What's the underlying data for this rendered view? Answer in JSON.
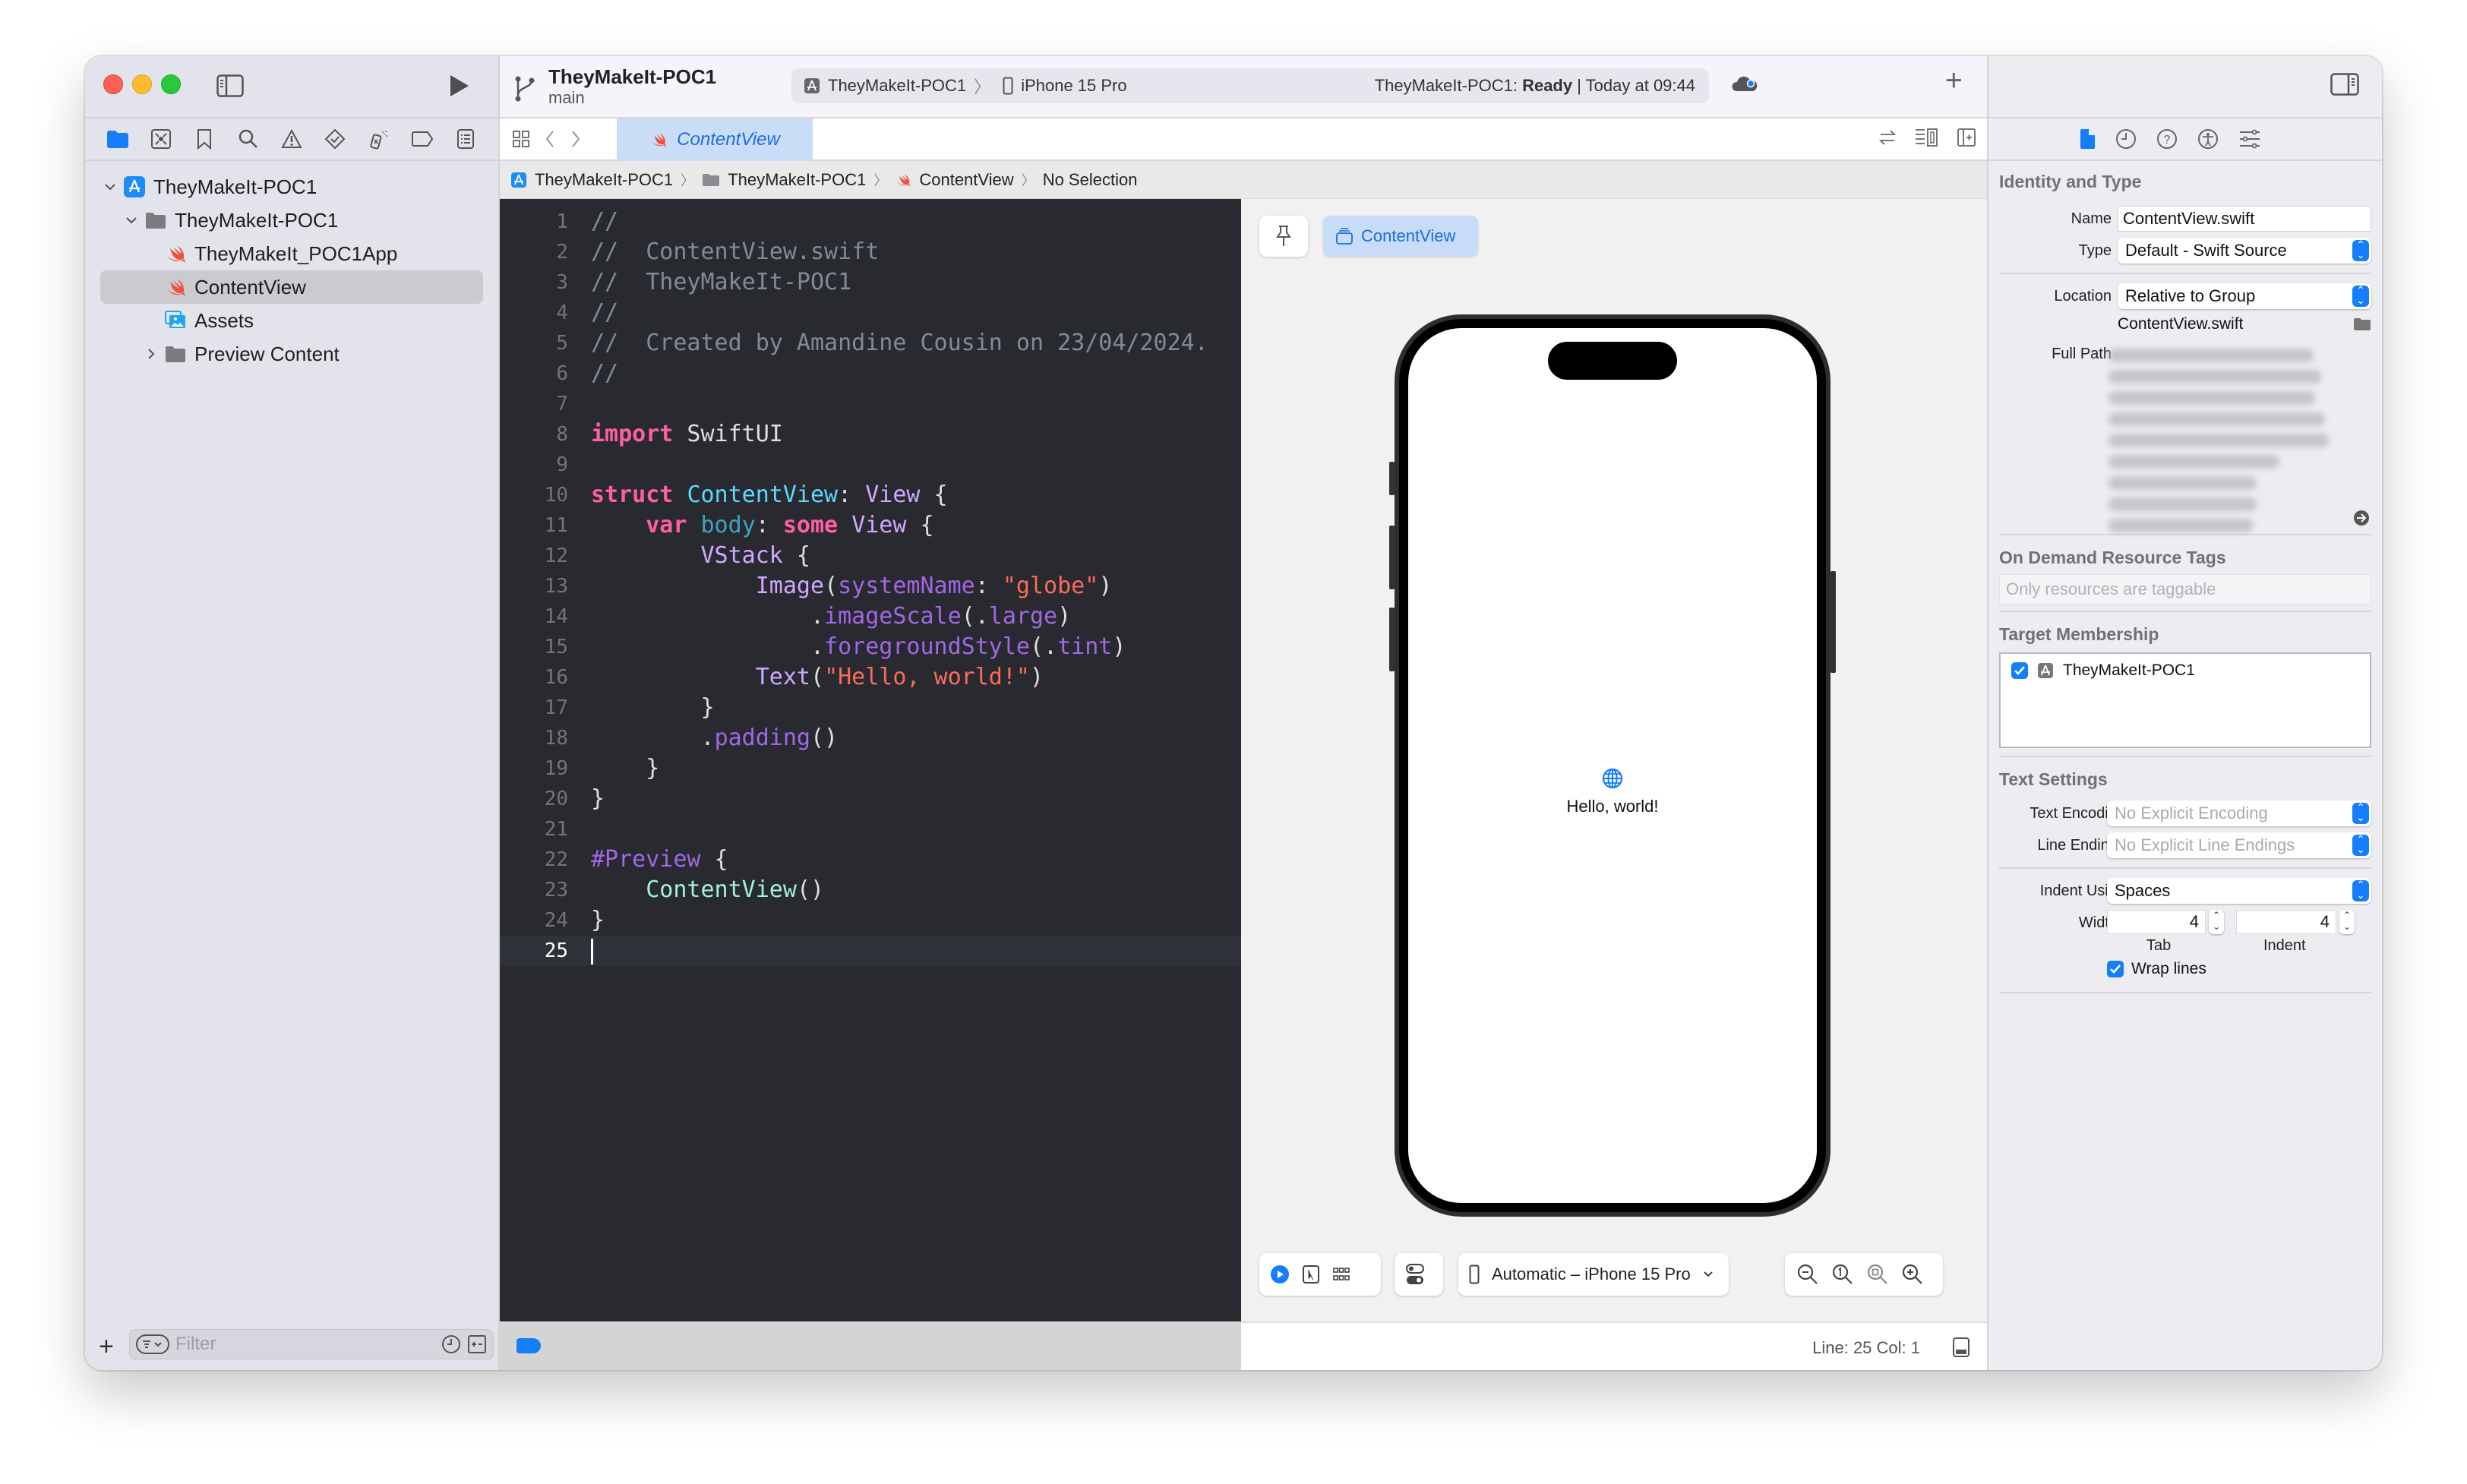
{
  "navigator": {
    "tabs": [
      "project-navigator",
      "source-control-navigator",
      "bookmark-navigator",
      "find-navigator",
      "issue-navigator",
      "test-navigator",
      "debug-navigator",
      "breakpoint-navigator",
      "report-navigator"
    ],
    "tree": [
      {
        "label": "TheyMakeIt-POC1",
        "type": "project",
        "depth": 0,
        "expanded": true
      },
      {
        "label": "TheyMakeIt-POC1",
        "type": "folder",
        "depth": 1,
        "expanded": true
      },
      {
        "label": "TheyMakeIt_POC1App",
        "type": "swift",
        "depth": 2
      },
      {
        "label": "ContentView",
        "type": "swift",
        "depth": 2,
        "selected": true
      },
      {
        "label": "Assets",
        "type": "assets",
        "depth": 2
      },
      {
        "label": "Preview Content",
        "type": "folder",
        "depth": 2,
        "expanded": false
      }
    ],
    "filter_placeholder": "Filter"
  },
  "toolbar": {
    "project_title": "TheyMakeIt-POC1",
    "branch": "main",
    "scheme": "TheyMakeIt-POC1",
    "destination": "iPhone 15 Pro",
    "status_prefix": "TheyMakeIt-POC1: ",
    "status_state": "Ready",
    "status_suffix": " | Today at 09:44"
  },
  "editor": {
    "tab_label": "ContentView",
    "jumpbar": [
      "TheyMakeIt-POC1",
      "TheyMakeIt-POC1",
      "ContentView",
      "No Selection"
    ],
    "current_line": 25,
    "lines": [
      [
        [
          "c",
          "//"
        ]
      ],
      [
        [
          "c",
          "//  ContentView.swift"
        ]
      ],
      [
        [
          "c",
          "//  TheyMakeIt-POC1"
        ]
      ],
      [
        [
          "c",
          "//"
        ]
      ],
      [
        [
          "c",
          "//  Created by Amandine Cousin on 23/04/2024."
        ]
      ],
      [
        [
          "c",
          "//"
        ]
      ],
      [],
      [
        [
          "k",
          "import"
        ],
        [
          "p",
          " SwiftUI"
        ]
      ],
      [],
      [
        [
          "k",
          "struct"
        ],
        [
          "p",
          " "
        ],
        [
          "t",
          "ContentView"
        ],
        [
          "p",
          ": "
        ],
        [
          "s",
          "View"
        ],
        [
          "p",
          " {"
        ]
      ],
      [
        [
          "p",
          "    "
        ],
        [
          "k",
          "var"
        ],
        [
          "p",
          " "
        ],
        [
          "r",
          "body"
        ],
        [
          "p",
          ": "
        ],
        [
          "k",
          "some"
        ],
        [
          "p",
          " "
        ],
        [
          "s",
          "View"
        ],
        [
          "p",
          " {"
        ]
      ],
      [
        [
          "p",
          "        "
        ],
        [
          "s",
          "VStack"
        ],
        [
          "p",
          " {"
        ]
      ],
      [
        [
          "p",
          "            "
        ],
        [
          "s",
          "Image"
        ],
        [
          "p",
          "("
        ],
        [
          "f",
          "systemName"
        ],
        [
          "p",
          ": "
        ],
        [
          "q",
          "\"globe\""
        ],
        [
          "p",
          ")"
        ]
      ],
      [
        [
          "p",
          "                ."
        ],
        [
          "f",
          "imageScale"
        ],
        [
          "p",
          "(."
        ],
        [
          "f",
          "large"
        ],
        [
          "p",
          ")"
        ]
      ],
      [
        [
          "p",
          "                ."
        ],
        [
          "f",
          "foregroundStyle"
        ],
        [
          "p",
          "(."
        ],
        [
          "f",
          "tint"
        ],
        [
          "p",
          ")"
        ]
      ],
      [
        [
          "p",
          "            "
        ],
        [
          "s",
          "Text"
        ],
        [
          "p",
          "("
        ],
        [
          "q",
          "\"Hello, world!\""
        ],
        [
          "p",
          ")"
        ]
      ],
      [
        [
          "p",
          "        }"
        ]
      ],
      [
        [
          "p",
          "        ."
        ],
        [
          "f",
          "padding"
        ],
        [
          "p",
          "()"
        ]
      ],
      [
        [
          "p",
          "    }"
        ]
      ],
      [
        [
          "p",
          "}"
        ]
      ],
      [],
      [
        [
          "m",
          "#Preview"
        ],
        [
          "p",
          " {"
        ]
      ],
      [
        [
          "p",
          "    "
        ],
        [
          "a",
          "ContentView"
        ],
        [
          "p",
          "()"
        ]
      ],
      [
        [
          "p",
          "}"
        ]
      ],
      []
    ]
  },
  "preview": {
    "pin_label": "pin",
    "view_button": "ContentView",
    "screen_text": "Hello, world!",
    "device_selector": "Automatic – iPhone 15 Pro"
  },
  "statusbar": {
    "line_col": "Line: 25  Col: 1"
  },
  "inspector": {
    "identity_title": "Identity and Type",
    "name_label": "Name",
    "name_value": "ContentView.swift",
    "type_label": "Type",
    "type_value": "Default - Swift Source",
    "location_label": "Location",
    "location_value": "Relative to Group",
    "location_file": "ContentView.swift",
    "fullpath_label": "Full Path",
    "fullpath_redacted_lines": 9,
    "odr_title": "On Demand Resource Tags",
    "odr_placeholder": "Only resources are taggable",
    "target_title": "Target Membership",
    "target_name": "TheyMakeIt-POC1",
    "target_checked": true,
    "text_title": "Text Settings",
    "encoding_label": "Text Encoding",
    "encoding_value": "No Explicit Encoding",
    "endings_label": "Line Endings",
    "endings_value": "No Explicit Line Endings",
    "indent_using_label": "Indent Using",
    "indent_using_value": "Spaces",
    "widths_label": "Widths",
    "tab_width": "4",
    "indent_width": "4",
    "tab_sub": "Tab",
    "indent_sub": "Indent",
    "wrap_label": "Wrap lines",
    "wrap_checked": true
  },
  "colors": {
    "accent": "#147efb",
    "swift_orange": "#f05138",
    "editor_bg": "#292a30"
  }
}
